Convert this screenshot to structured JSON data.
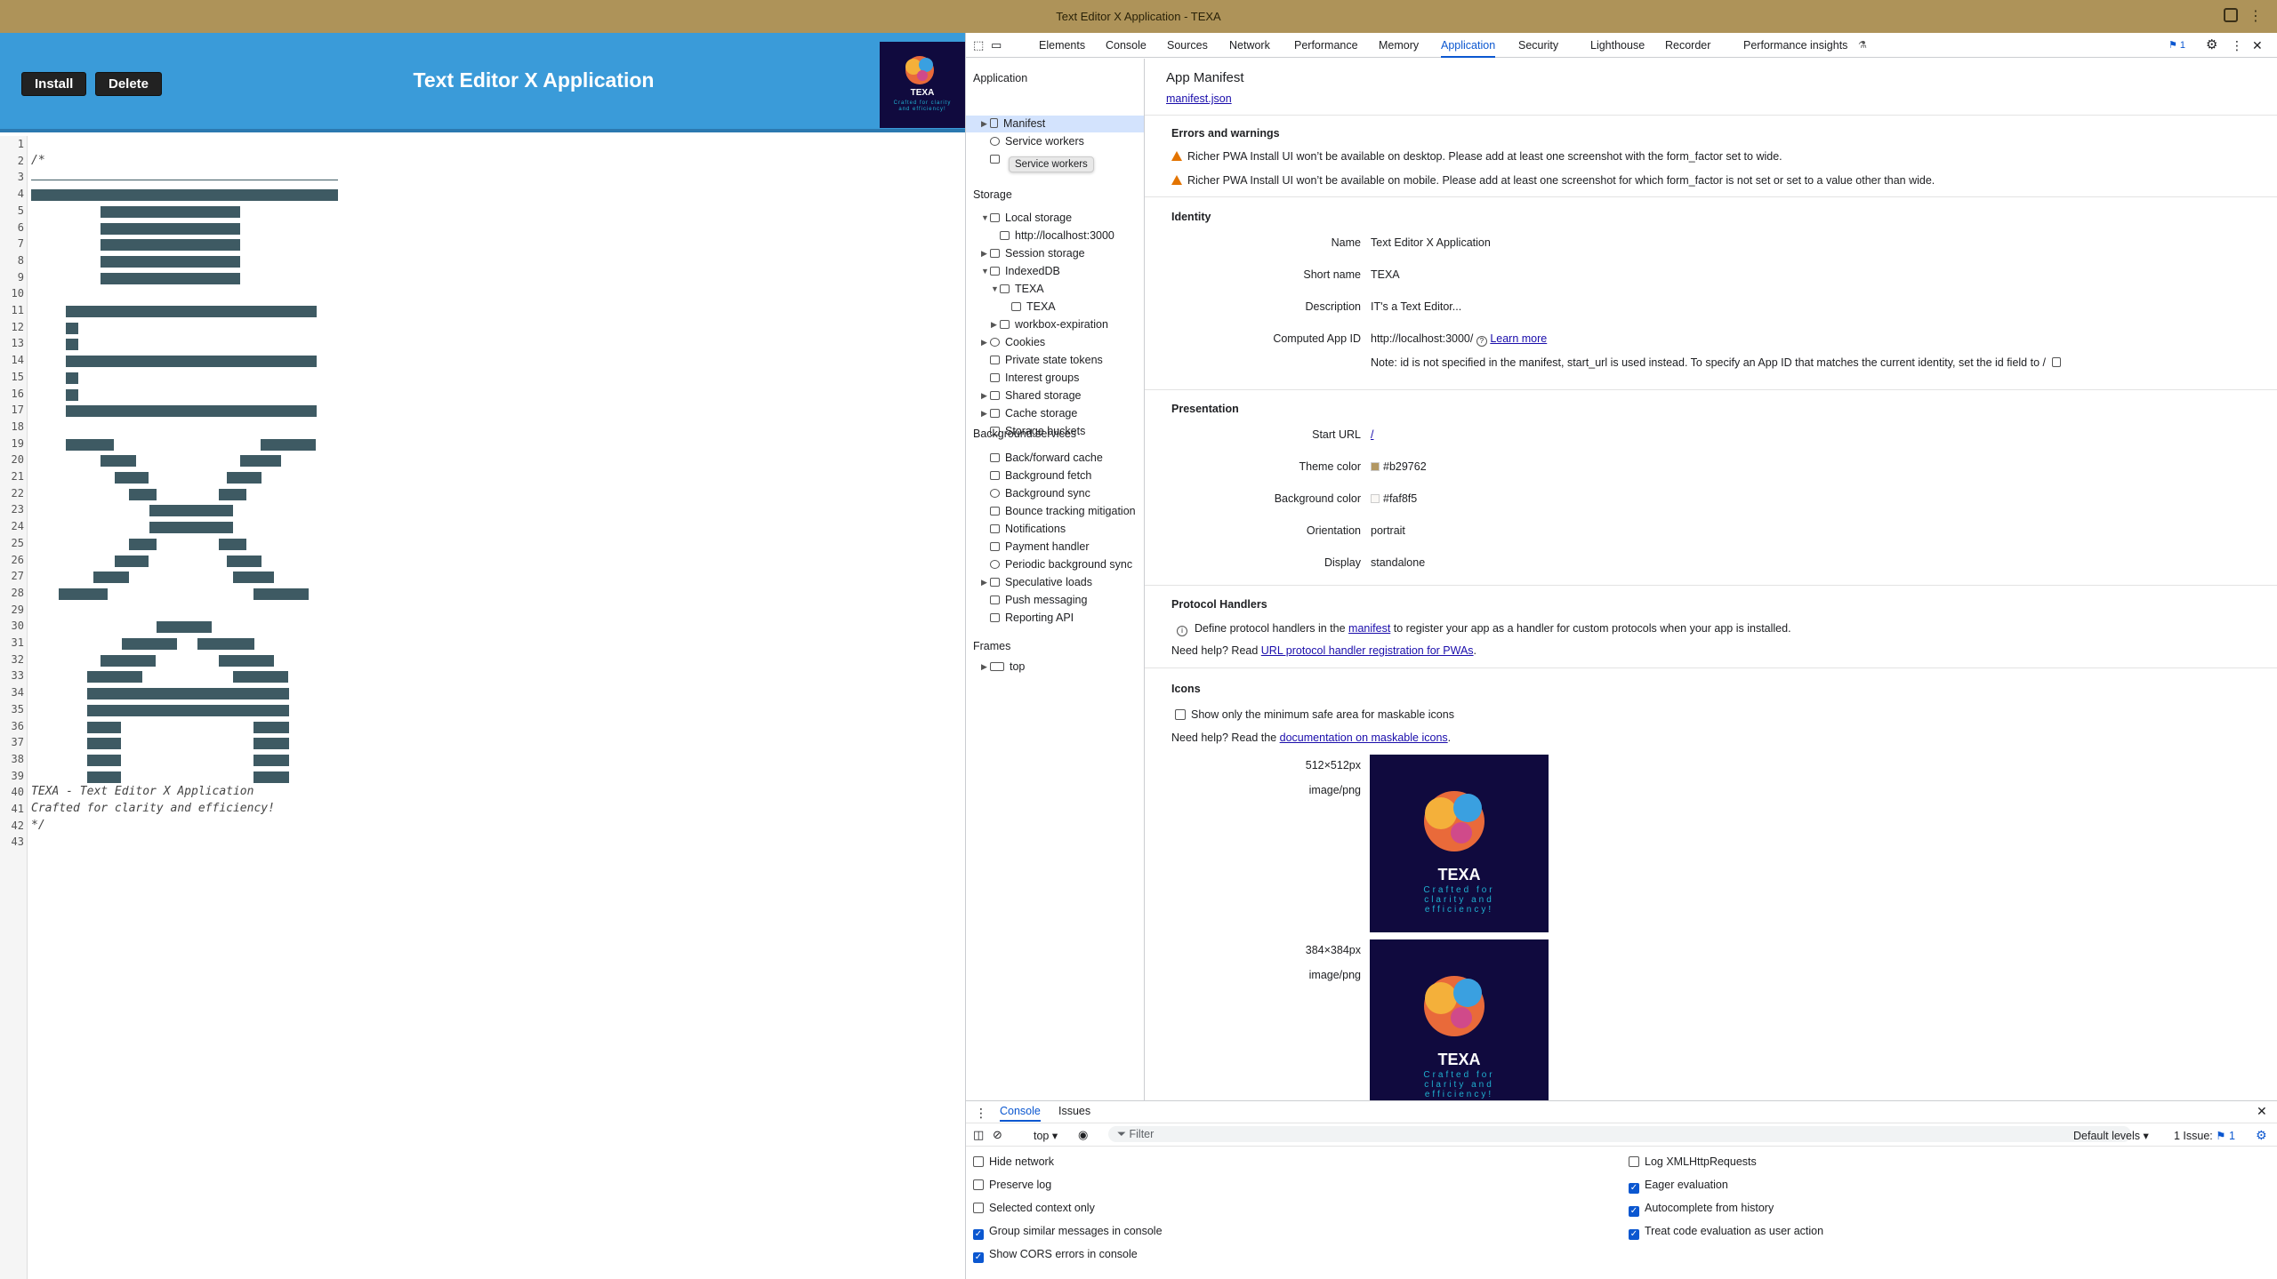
{
  "window": {
    "title": "Text Editor X Application - TEXA"
  },
  "app": {
    "install_label": "Install",
    "delete_label": "Delete",
    "title": "Text Editor X Application",
    "logo": {
      "text": "TEXA",
      "tagline": "Crafted for clarity and efficiency!"
    }
  },
  "editor": {
    "line_count": 43,
    "lines": {
      "2": "/*",
      "40": "TEXA - Text Editor X Application",
      "41": "Crafted for clarity and efficiency!",
      "42": "*/"
    }
  },
  "devtools": {
    "tabs": [
      "Elements",
      "Console",
      "Sources",
      "Network",
      "Performance",
      "Memory",
      "Application",
      "Security",
      "Lighthouse",
      "Recorder",
      "Performance insights"
    ],
    "active_tab": "Application",
    "issues_badge": "1",
    "sidebar": {
      "application_header": "Application",
      "application_items": [
        "Manifest",
        "Service workers",
        "Storage"
      ],
      "tooltip": "Service workers",
      "storage_header": "Storage",
      "storage_items": [
        "Local storage",
        "http://localhost:3000",
        "Session storage",
        "IndexedDB",
        "TEXA",
        "TEXA",
        "workbox-expiration",
        "Cookies",
        "Private state tokens",
        "Interest groups",
        "Shared storage",
        "Cache storage",
        "Storage buckets"
      ],
      "background_header": "Background services",
      "background_items": [
        "Back/forward cache",
        "Background fetch",
        "Background sync",
        "Bounce tracking mitigation",
        "Notifications",
        "Payment handler",
        "Periodic background sync",
        "Speculative loads",
        "Push messaging",
        "Reporting API"
      ],
      "frames_header": "Frames",
      "frames_items": [
        "top"
      ]
    },
    "manifest": {
      "title": "App Manifest",
      "link": "manifest.json",
      "errors_title": "Errors and warnings",
      "warnings": [
        "Richer PWA Install UI won’t be available on desktop. Please add at least one screenshot with the form_factor set to wide.",
        "Richer PWA Install UI won’t be available on mobile. Please add at least one screenshot for which form_factor is not set or set to a value other than wide."
      ],
      "identity_title": "Identity",
      "identity": {
        "name_label": "Name",
        "name": "Text Editor X Application",
        "short_label": "Short name",
        "short": "TEXA",
        "desc_label": "Description",
        "desc": "IT's a Text Editor...",
        "appid_label": "Computed App ID",
        "appid": "http://localhost:3000/",
        "learn_more": "Learn more",
        "note": "Note: id is not specified in the manifest, start_url is used instead. To specify an App ID that matches the current identity, set the id field to /"
      },
      "presentation_title": "Presentation",
      "presentation": {
        "start_label": "Start URL",
        "start": "/",
        "theme_label": "Theme color",
        "theme": "#b29762",
        "bg_label": "Background color",
        "bg": "#faf8f5",
        "orient_label": "Orientation",
        "orient": "portrait",
        "display_label": "Display",
        "display": "standalone"
      },
      "protocol_title": "Protocol Handlers",
      "protocol_text1": "Define protocol handlers in the",
      "protocol_link": "manifest",
      "protocol_text2": "to register your app as a handler for custom protocols when your app is installed.",
      "protocol_help": "Need help? Read",
      "protocol_help_link": "URL protocol handler registration for PWAs",
      "icons_title": "Icons",
      "icons_checkbox": "Show only the minimum safe area for maskable icons",
      "icons_help": "Need help? Read the",
      "icons_help_link": "documentation on maskable icons",
      "icons": [
        {
          "size": "512×512px",
          "type": "image/png"
        },
        {
          "size": "384×384px",
          "type": "image/png"
        }
      ]
    },
    "console": {
      "tabs": [
        "Console",
        "Issues"
      ],
      "context": "top",
      "filter_placeholder": "Filter",
      "levels": "Default levels",
      "issues": "1 Issue:",
      "issues_count": "1",
      "left_options": [
        {
          "label": "Hide network",
          "checked": false
        },
        {
          "label": "Preserve log",
          "checked": false
        },
        {
          "label": "Selected context only",
          "checked": false
        },
        {
          "label": "Group similar messages in console",
          "checked": true
        },
        {
          "label": "Show CORS errors in console",
          "checked": true
        }
      ],
      "right_options": [
        {
          "label": "Log XMLHttpRequests",
          "checked": false
        },
        {
          "label": "Eager evaluation",
          "checked": true
        },
        {
          "label": "Autocomplete from history",
          "checked": true
        },
        {
          "label": "Treat code evaluation as user action",
          "checked": true
        }
      ]
    }
  }
}
